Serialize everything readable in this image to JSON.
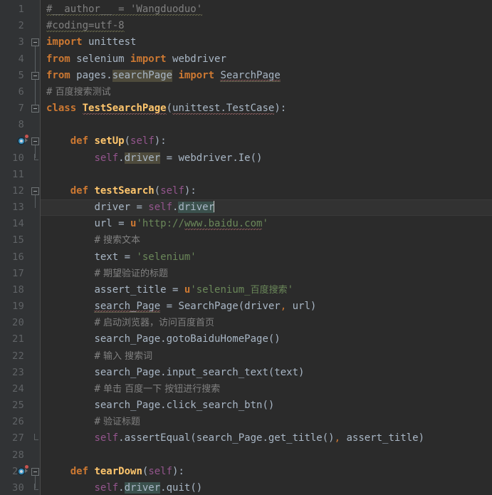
{
  "editor": {
    "language": "Python",
    "theme": "Darcula",
    "background_color": "#2b2b2b",
    "gutter_color": "#313335",
    "current_line_color": "#323232",
    "line_number_color": "#606366",
    "default_text_color": "#a9b7c6",
    "keyword_color": "#cc7832",
    "string_color": "#6a8759",
    "comment_color": "#808080",
    "class_color": "#ffc66d",
    "self_color": "#94558d",
    "field_color": "#9876aa",
    "highlight_color": "#3b514d",
    "caret_line": 13,
    "total_lines": 30
  },
  "gutter": {
    "line_numbers": [
      "1",
      "2",
      "3",
      "4",
      "5",
      "6",
      "7",
      "8",
      "9",
      "10",
      "11",
      "12",
      "13",
      "14",
      "15",
      "16",
      "17",
      "18",
      "19",
      "20",
      "21",
      "22",
      "23",
      "24",
      "25",
      "26",
      "27",
      "28",
      "29",
      "30"
    ],
    "run_icon_lines": [
      9,
      29
    ],
    "fold_marker_lines": [
      3,
      5,
      7,
      9,
      10,
      12,
      27,
      29,
      30
    ],
    "run_icon_name": "run-test-icon",
    "fold_icon_name": "code-fold-icon"
  },
  "code": {
    "lines": [
      {
        "n": 1,
        "text": "#__author__ = 'Wangduoduo'"
      },
      {
        "n": 2,
        "text": "#coding=utf-8"
      },
      {
        "n": 3,
        "text": "import unittest"
      },
      {
        "n": 4,
        "text": "from selenium import webdriver"
      },
      {
        "n": 5,
        "text": "from pages.searchPage import SearchPage"
      },
      {
        "n": 6,
        "text": "# 百度搜索测试"
      },
      {
        "n": 7,
        "text": "class TestSearchPage(unittest.TestCase):"
      },
      {
        "n": 8,
        "text": ""
      },
      {
        "n": 9,
        "text": "    def setUp(self):"
      },
      {
        "n": 10,
        "text": "        self.driver = webdriver.Ie()"
      },
      {
        "n": 11,
        "text": ""
      },
      {
        "n": 12,
        "text": "    def testSearch(self):"
      },
      {
        "n": 13,
        "text": "        driver = self.driver"
      },
      {
        "n": 14,
        "text": "        url = u'http://www.baidu.com'"
      },
      {
        "n": 15,
        "text": "        # 搜索文本"
      },
      {
        "n": 16,
        "text": "        text = 'selenium'"
      },
      {
        "n": 17,
        "text": "        # 期望验证的标题"
      },
      {
        "n": 18,
        "text": "        assert_title = u'selenium_百度搜索'"
      },
      {
        "n": 19,
        "text": "        search_Page = SearchPage(driver, url)"
      },
      {
        "n": 20,
        "text": "        # 启动浏览器，访问百度首页"
      },
      {
        "n": 21,
        "text": "        search_Page.gotoBaiduHomePage()"
      },
      {
        "n": 22,
        "text": "        # 输入 搜索词"
      },
      {
        "n": 23,
        "text": "        search_Page.input_search_text(text)"
      },
      {
        "n": 24,
        "text": "        # 单击 百度一下 按钮进行搜索"
      },
      {
        "n": 25,
        "text": "        search_Page.click_search_btn()"
      },
      {
        "n": 26,
        "text": "        # 验证标题"
      },
      {
        "n": 27,
        "text": "        self.assertEqual(search_Page.get_title(), assert_title)"
      },
      {
        "n": 28,
        "text": ""
      },
      {
        "n": 29,
        "text": "    def tearDown(self):"
      },
      {
        "n": 30,
        "text": "        self.driver.quit()"
      }
    ]
  }
}
